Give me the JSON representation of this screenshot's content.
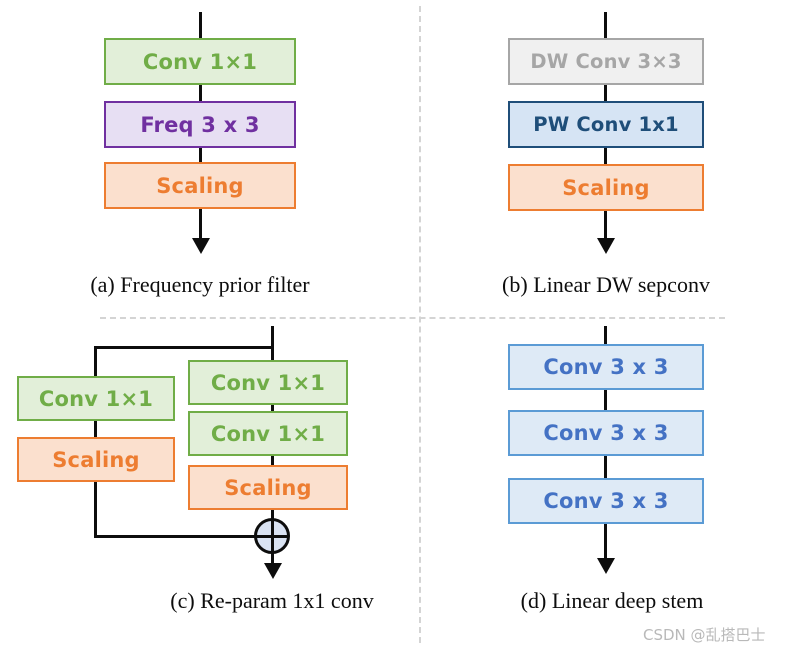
{
  "figure": {
    "watermark": "CSDN @乱搭巴士"
  },
  "panels": {
    "a": {
      "caption": "(a) Frequency prior filter",
      "blocks": [
        {
          "label": "Conv 1×1",
          "style": "green"
        },
        {
          "label": "Freq 3 x 3",
          "style": "purple"
        },
        {
          "label": "Scaling",
          "style": "orange"
        }
      ]
    },
    "b": {
      "caption": "(b) Linear DW sepconv",
      "blocks": [
        {
          "label": "DW Conv 3×3",
          "style": "grey"
        },
        {
          "label": "PW Conv 1x1",
          "style": "blue"
        },
        {
          "label": "Scaling",
          "style": "orange"
        }
      ]
    },
    "c": {
      "caption": "(c) Re-param 1x1 conv",
      "left_branch": [
        {
          "label": "Conv 1×1",
          "style": "green"
        },
        {
          "label": "Scaling",
          "style": "orange"
        }
      ],
      "right_branch": [
        {
          "label": "Conv 1×1",
          "style": "green"
        },
        {
          "label": "Conv 1×1",
          "style": "green"
        },
        {
          "label": "Scaling",
          "style": "orange"
        }
      ],
      "merge_op": "add"
    },
    "d": {
      "caption": "(d) Linear deep stem",
      "blocks": [
        {
          "label": "Conv 3 x 3",
          "style": "lblue"
        },
        {
          "label": "Conv 3 x 3",
          "style": "lblue"
        },
        {
          "label": "Conv 3 x 3",
          "style": "lblue"
        }
      ]
    }
  },
  "colors": {
    "green_fill": "#e2efd9",
    "green_stroke": "#70ad47",
    "purple_fill": "#e7dff3",
    "purple_stroke": "#7030a0",
    "orange_fill": "#fbe0ce",
    "orange_stroke": "#ed7d31",
    "grey_fill": "#f0f0f0",
    "grey_stroke": "#a6a6a6",
    "blue_fill": "#d6e4f4",
    "blue_stroke": "#1f4e79",
    "lblue_fill": "#deeaf6",
    "lblue_stroke": "#5b9bd5",
    "line": "#0d0d0d",
    "divider": "#d4d4d4",
    "sum_fill": "#dae3f3"
  }
}
